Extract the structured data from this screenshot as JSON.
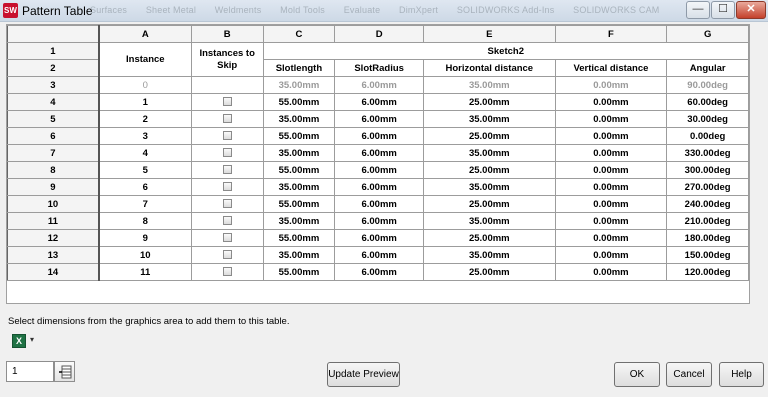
{
  "window": {
    "title": "Pattern Table",
    "app_icon_text": "SW",
    "background_menu": [
      "Surfaces",
      "Sheet Metal",
      "Weldments",
      "Mold Tools",
      "Evaluate",
      "DimXpert",
      "SOLIDWORKS Add-Ins",
      "SOLIDWORKS CAM"
    ],
    "minimize": "—",
    "maximize": "☐",
    "close": "✕"
  },
  "table": {
    "column_letters": [
      "A",
      "B",
      "C",
      "D",
      "E",
      "F",
      "G"
    ],
    "header_row_numbers": [
      "1",
      "2"
    ],
    "instance_header": "Instance",
    "skip_header": "Instances to Skip",
    "group_header": "Sketch2",
    "param_headers": [
      "Slotlength",
      "SlotRadius",
      "Horizontal distance",
      "Vertical distance",
      "Angular"
    ],
    "rows": [
      {
        "num": "3",
        "instance": "0",
        "slotlength": "35.00mm",
        "slotradius": "6.00mm",
        "horizontal": "35.00mm",
        "vertical": "0.00mm",
        "angular": "90.00deg"
      },
      {
        "num": "4",
        "instance": "1",
        "slotlength": "55.00mm",
        "slotradius": "6.00mm",
        "horizontal": "25.00mm",
        "vertical": "0.00mm",
        "angular": "60.00deg"
      },
      {
        "num": "5",
        "instance": "2",
        "slotlength": "35.00mm",
        "slotradius": "6.00mm",
        "horizontal": "35.00mm",
        "vertical": "0.00mm",
        "angular": "30.00deg"
      },
      {
        "num": "6",
        "instance": "3",
        "slotlength": "55.00mm",
        "slotradius": "6.00mm",
        "horizontal": "25.00mm",
        "vertical": "0.00mm",
        "angular": "0.00deg"
      },
      {
        "num": "7",
        "instance": "4",
        "slotlength": "35.00mm",
        "slotradius": "6.00mm",
        "horizontal": "35.00mm",
        "vertical": "0.00mm",
        "angular": "330.00deg"
      },
      {
        "num": "8",
        "instance": "5",
        "slotlength": "55.00mm",
        "slotradius": "6.00mm",
        "horizontal": "25.00mm",
        "vertical": "0.00mm",
        "angular": "300.00deg"
      },
      {
        "num": "9",
        "instance": "6",
        "slotlength": "35.00mm",
        "slotradius": "6.00mm",
        "horizontal": "35.00mm",
        "vertical": "0.00mm",
        "angular": "270.00deg"
      },
      {
        "num": "10",
        "instance": "7",
        "slotlength": "55.00mm",
        "slotradius": "6.00mm",
        "horizontal": "25.00mm",
        "vertical": "0.00mm",
        "angular": "240.00deg"
      },
      {
        "num": "11",
        "instance": "8",
        "slotlength": "35.00mm",
        "slotradius": "6.00mm",
        "horizontal": "35.00mm",
        "vertical": "0.00mm",
        "angular": "210.00deg"
      },
      {
        "num": "12",
        "instance": "9",
        "slotlength": "55.00mm",
        "slotradius": "6.00mm",
        "horizontal": "25.00mm",
        "vertical": "0.00mm",
        "angular": "180.00deg"
      },
      {
        "num": "13",
        "instance": "10",
        "slotlength": "35.00mm",
        "slotradius": "6.00mm",
        "horizontal": "35.00mm",
        "vertical": "0.00mm",
        "angular": "150.00deg"
      },
      {
        "num": "14",
        "instance": "11",
        "slotlength": "55.00mm",
        "slotradius": "6.00mm",
        "horizontal": "25.00mm",
        "vertical": "0.00mm",
        "angular": "120.00deg"
      }
    ]
  },
  "footer": {
    "hint": "Select dimensions from the graphics area to add them to this table.",
    "excel_icon": "excel-export-icon",
    "spinner_value": "1",
    "update_preview": "Update Preview",
    "ok": "OK",
    "cancel": "Cancel",
    "help": "Help"
  }
}
